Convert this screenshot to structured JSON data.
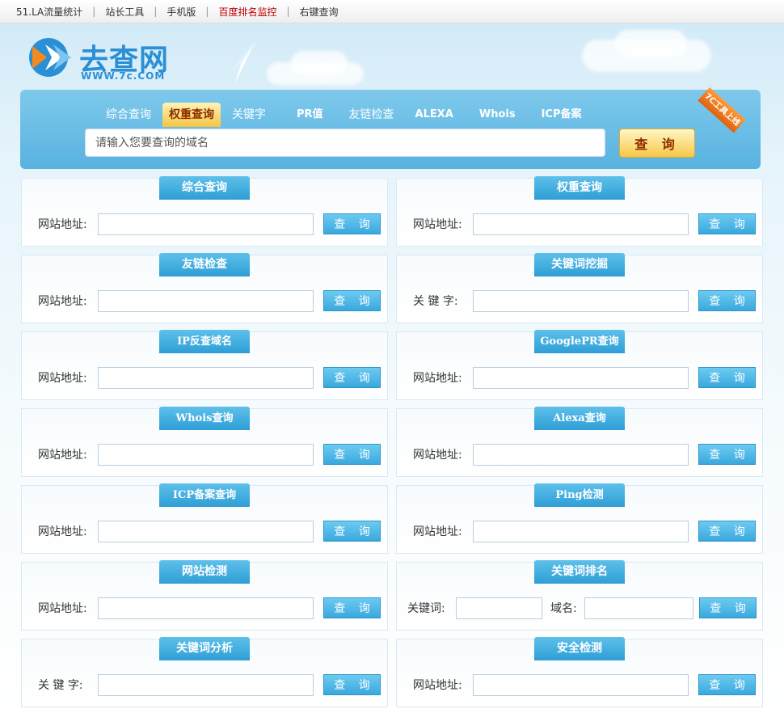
{
  "topnav": [
    {
      "label": "51.LA流量统计",
      "highlight": false
    },
    {
      "label": "站长工具",
      "highlight": false
    },
    {
      "label": "手机版",
      "highlight": false
    },
    {
      "label": "百度排名监控",
      "highlight": true
    },
    {
      "label": "右键查询",
      "highlight": false
    }
  ],
  "logo": {
    "name": "去查网",
    "url": "WWW.7c.COM"
  },
  "search": {
    "tabs": [
      "综合查询",
      "权重查询",
      "关键字",
      "PR值",
      "友链检查",
      "ALEXA",
      "Whois",
      "ICP备案"
    ],
    "active_tab": "权重查询",
    "placeholder": "请输入您要查询的域名",
    "button": "查 询",
    "ribbon": "7C工具上线"
  },
  "cards": [
    {
      "title": "综合查询",
      "label": "网站地址:",
      "button": "查 询"
    },
    {
      "title": "权重查询",
      "label": "网站地址:",
      "button": "查 询"
    },
    {
      "title": "友链检查",
      "label": "网站地址:",
      "button": "查 询"
    },
    {
      "title": "关键词挖掘",
      "label": "关 键 字:",
      "button": "查 询"
    },
    {
      "title": "IP反查域名",
      "label": "网站地址:",
      "button": "查 询"
    },
    {
      "title": "GooglePR查询",
      "label": "网站地址:",
      "button": "查 询"
    },
    {
      "title": "Whois查询",
      "label": "网站地址:",
      "button": "查 询"
    },
    {
      "title": "Alexa查询",
      "label": "网站地址:",
      "button": "查 询"
    },
    {
      "title": "ICP备案查询",
      "label": "网站地址:",
      "button": "查 询"
    },
    {
      "title": "Ping检测",
      "label": "网站地址:",
      "button": "查 询"
    },
    {
      "title": "网站检测",
      "label": "网站地址:",
      "button": "查 询"
    },
    {
      "title": "关键词排名",
      "label": "关键词:",
      "label2": "域名:",
      "button": "查 询"
    },
    {
      "title": "关键词分析",
      "label": "关 键 字:",
      "button": "查 询"
    },
    {
      "title": "安全检测",
      "label": "网站地址:",
      "button": "查 询"
    }
  ],
  "colors": {
    "accent": "#2e9ed6",
    "highlight": "#c00000",
    "button_gold": "#f7c848"
  }
}
